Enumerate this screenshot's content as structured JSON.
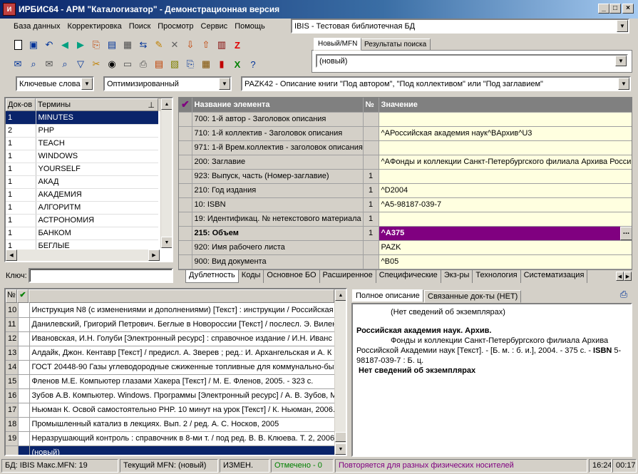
{
  "window": {
    "title": "ИРБИС64 - АРМ \"Каталогизатор\" - Демонстрационная версия",
    "app_icon": "irbis-app-icon"
  },
  "menu": [
    "База данных",
    "Корректировка",
    "Поиск",
    "Просмотр",
    "Сервис",
    "Помощь"
  ],
  "db_select": {
    "value": "IBIS - Тестовая библиотечная БД"
  },
  "right_tabs": [
    "Новый/MFN",
    "Результаты поиска"
  ],
  "mfn_select": {
    "value": "(новый)"
  },
  "dict_select": {
    "value": "Ключевые слова"
  },
  "mode_select": {
    "value": "Оптимизированный"
  },
  "worksheet_select": {
    "value": "PAZK42 - Описание книги \"Под автором\", \"Под коллективом\" или \"Под заглавием\""
  },
  "terms": {
    "headers": [
      "Док-ов",
      "Термины"
    ],
    "rows": [
      [
        "1",
        "MINUTES"
      ],
      [
        "2",
        "PHP"
      ],
      [
        "1",
        "TEACH"
      ],
      [
        "1",
        "WINDOWS"
      ],
      [
        "1",
        "YOURSELF"
      ],
      [
        "1",
        "АКАД"
      ],
      [
        "1",
        "АКАДЕМИЯ"
      ],
      [
        "1",
        "АЛГОРИТМ"
      ],
      [
        "1",
        "АСТРОНОМИЯ"
      ],
      [
        "1",
        "БАНКОМ"
      ],
      [
        "1",
        "БЕГЛЫЕ"
      ]
    ],
    "selected_index": 0,
    "key_label": "Ключ:"
  },
  "fields": {
    "headers": [
      "Название элемента",
      "№",
      "Значение"
    ],
    "rows": [
      {
        "name": "700: 1-й  автор - Заголовок описания",
        "num": "",
        "value": ""
      },
      {
        "name": "710: 1-й коллектив - Заголовок описания",
        "num": "",
        "value": "^AРоссийская академия наук^BАрхив^U3"
      },
      {
        "name": "971: 1-й Врем.коллектив - заголовок описания",
        "num": "",
        "value": ""
      },
      {
        "name": "200: Заглавие",
        "num": "",
        "value": "^AФонды и коллекции Санкт-Петербургского филиала Архива Российской"
      },
      {
        "name": "923: Выпуск, часть (Номер-заглавие)",
        "num": "1",
        "value": ""
      },
      {
        "name": "210: Год издания",
        "num": "1",
        "value": "^D2004"
      },
      {
        "name": "10: ISBN",
        "num": "1",
        "value": "^A5-98187-039-7"
      },
      {
        "name": "19: Идентификац. № нетекстового материала",
        "num": "1",
        "value": ""
      },
      {
        "name": "215: Объем",
        "num": "1",
        "value": "^A375",
        "selected": true
      },
      {
        "name": "920: Имя рабочего листа",
        "num": "",
        "value": "PAZK"
      },
      {
        "name": "900: Вид документа",
        "num": "",
        "value": "^B05"
      }
    ],
    "more_button": "...",
    "tabs": [
      "Дублетность",
      "Коды",
      "Основное БО",
      "Расширенное",
      "Специфические",
      "Экз-ры",
      "Технология",
      "Систематизация"
    ]
  },
  "records": {
    "header_num": "№",
    "rows": [
      {
        "num": "10",
        "text": "Инструкция N8   (с изменениями и дополнениями) [Текст] : инструкции / Российская"
      },
      {
        "num": "11",
        "text": "Данилевский, Григорий Петрович. Беглые в Новороссии [Текст] / послесл. Э. Вилен"
      },
      {
        "num": "12",
        "text": "Ивановская, И.Н. Голуби [Электронный ресурс] : справочное издание / И.Н. Иванс"
      },
      {
        "num": "13",
        "text": "Алдайк, Джон. Кентавр [Текст] / предисл. А. Зверев ; ред.: И. Архангельская и А. К"
      },
      {
        "num": "14",
        "text": "ГОСТ 20448-90 Газы углеводородные сжиженные топливные для коммунально-быт"
      },
      {
        "num": "15",
        "text": "Фленов М.Е. Компьютер глазами Хакера [Текст] / М. Е. Фленов, 2005. - 323 с."
      },
      {
        "num": "16",
        "text": "Зубов А.В. Компьютер. Windows. Программы [Электронный ресурс] / А. В. Зубов, М"
      },
      {
        "num": "17",
        "text": "Ньюман К. Освой самостоятельно PHP. 10 минут на урок [Текст] / К. Ньюман, 2006."
      },
      {
        "num": "18",
        "text": "Промышленный катализ в лекциях. Вып. 2 / ред. А. С. Носков, 2005"
      },
      {
        "num": "19",
        "text": "Неразрушающий контроль : справочник в 8-ми т. / под ред. В. В. Клюева. Т. 2, 2006."
      },
      {
        "num": "",
        "text": "(новый)",
        "selected": true
      }
    ]
  },
  "preview": {
    "tabs": [
      "Полное описание",
      "Связанные док-ты (НЕТ)"
    ],
    "line1": "(Нет сведений об экземплярах)",
    "heading": "Российская академия наук. Архив.",
    "body_prefix": "Фонды и коллекции Санкт-Петербургского филиала Архива Российской Академии наук [Текст]. - [Б. м. : б. и.], 2004. - 375 с. - ",
    "isbn_label": "ISBN",
    "body_suffix": " 5-98187-039-7 : Б. ц.",
    "footer": "Нет сведений об экземплярах"
  },
  "status": {
    "db": "БД: IBIS Макс.MFN: 19",
    "current": "Текущий MFN: (новый)",
    "modified": "ИЗМЕН.",
    "marked": "Отмечено - 0",
    "message": "Повторяется для разных физических носителей",
    "time": "16:24",
    "elapsed": "00:17"
  },
  "colors": {
    "selected_row": "#0a246a",
    "selected_field": "#800080",
    "value_bg": "#ffffe0",
    "marked": "#008000",
    "message": "#800080"
  }
}
